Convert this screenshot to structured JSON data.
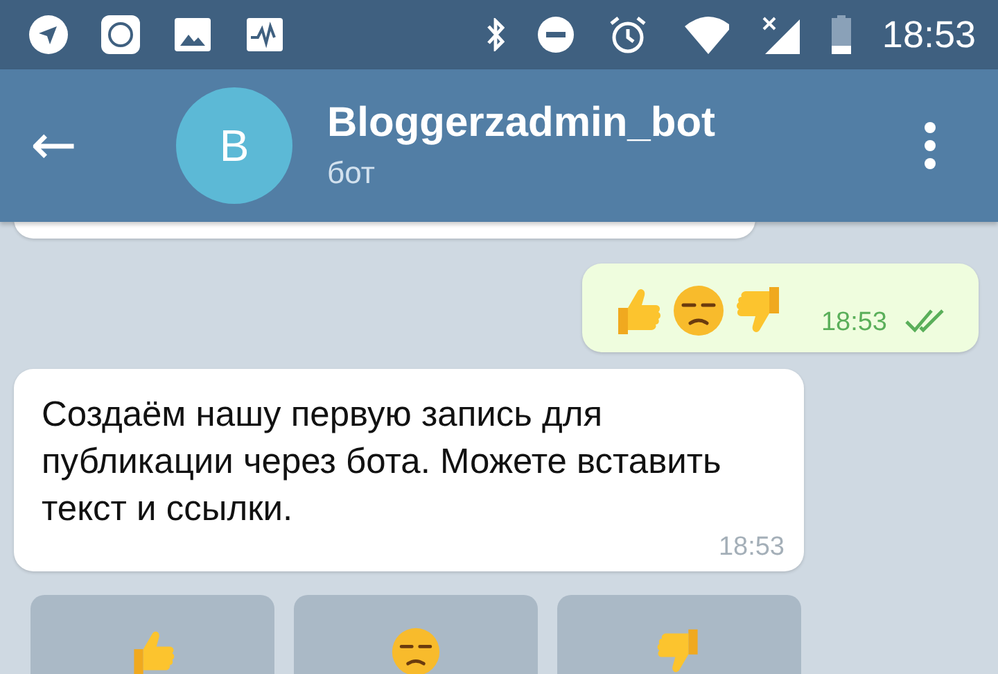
{
  "status_bar": {
    "time": "18:53"
  },
  "header": {
    "back": "←",
    "avatar_letter": "B",
    "title": "Bloggerzadmin_bot",
    "subtitle": "бот"
  },
  "messages": [
    {
      "kind": "cut",
      "outgoing": false
    },
    {
      "kind": "emoji",
      "outgoing": true,
      "emojis": [
        {
          "kind": "thumbs_up"
        },
        {
          "kind": "unamused"
        },
        {
          "kind": "thumbs_down"
        }
      ],
      "time": "18:53",
      "read": true
    },
    {
      "kind": "text",
      "outgoing": false,
      "text": "Создаём нашу первую запись для публикации через бота. Можете вставить текст и ссылки.",
      "time": "18:53"
    }
  ],
  "keyboard": [
    {
      "kind": "thumbs_up"
    },
    {
      "kind": "unamused"
    },
    {
      "kind": "thumbs_down"
    }
  ]
}
